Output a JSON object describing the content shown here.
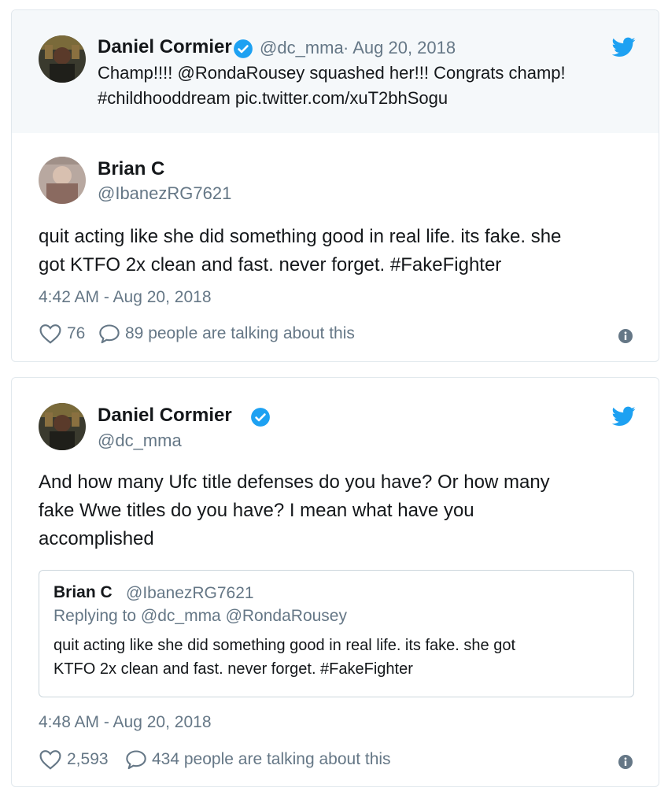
{
  "card1": {
    "parent_tweet": {
      "author_name": "Daniel Cormier",
      "author_handle": "@dc_mma",
      "separator_date": "· Aug 20, 2018",
      "text_line1": "Champ!!!! @RondaRousey squashed her!!! Congrats champ!",
      "text_line2": "#childhooddream pic.twitter.com/xuT2bhSogu",
      "avatar_icon": "avatar-daniel-cormier",
      "bird_icon": "twitter-bird-icon",
      "verified_icon": "verified-badge-icon"
    },
    "tweet": {
      "author_name": "Brian C",
      "author_handle": "@IbanezRG7621",
      "text_line1": "quit acting like she did something good in real life.  its fake.  she",
      "text_line2": "got KTFO 2x clean and fast.  never forget.  #FakeFighter",
      "timestamp": "4:42 AM - Aug 20, 2018",
      "likes": "76",
      "replies_text": "89 people are talking about this",
      "avatar_icon": "avatar-brian-c"
    }
  },
  "card2": {
    "tweet": {
      "author_name": "Daniel Cormier",
      "author_handle": "@dc_mma",
      "text_line1": "And how many Ufc title defenses do you have? Or how many",
      "text_line2": "fake Wwe titles do you have? I mean what have you",
      "text_line3": "accomplished",
      "timestamp": "4:48 AM - Aug 20, 2018",
      "likes": "2,593",
      "replies_text": "434 people are talking about this",
      "avatar_icon": "avatar-daniel-cormier",
      "bird_icon": "twitter-bird-icon",
      "verified_icon": "verified-badge-icon"
    },
    "quote": {
      "author_name": "Brian C",
      "author_handle": "@IbanezRG7621",
      "replying_to": "Replying to @dc_mma @RondaRousey",
      "text_line1": "quit acting like she did something good in real life.  its fake.  she got",
      "text_line2": "KTFO 2x clean and fast.  never forget.  #FakeFighter"
    }
  },
  "colors": {
    "twitter_blue": "#1da1f2",
    "secondary_text": "#657786",
    "border": "#e1e8ed",
    "parent_bg": "#f5f8fa"
  }
}
